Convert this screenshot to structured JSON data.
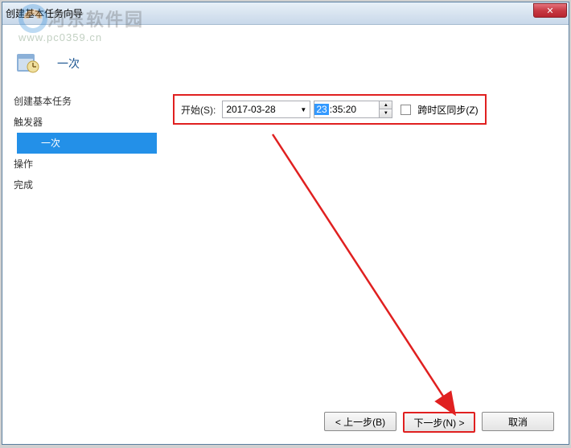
{
  "window": {
    "title": "创建基本任务向导"
  },
  "watermark": {
    "text": "河东软件园",
    "url": "www.pc0359.cn"
  },
  "header": {
    "title": "一次"
  },
  "sidebar": {
    "items": [
      {
        "label": "创建基本任务",
        "indent": false
      },
      {
        "label": "触发器",
        "indent": false
      },
      {
        "label": "一次",
        "indent": true,
        "active": true
      },
      {
        "label": "操作",
        "indent": false
      },
      {
        "label": "完成",
        "indent": false
      }
    ]
  },
  "form": {
    "start_label": "开始(S):",
    "date_value": "2017-03-28",
    "time_hour": "23",
    "time_rest": ":35:20",
    "timezone_label": "跨时区同步(Z)"
  },
  "footer": {
    "back_label": "< 上一步(B)",
    "next_label": "下一步(N) >",
    "cancel_label": "取消"
  }
}
